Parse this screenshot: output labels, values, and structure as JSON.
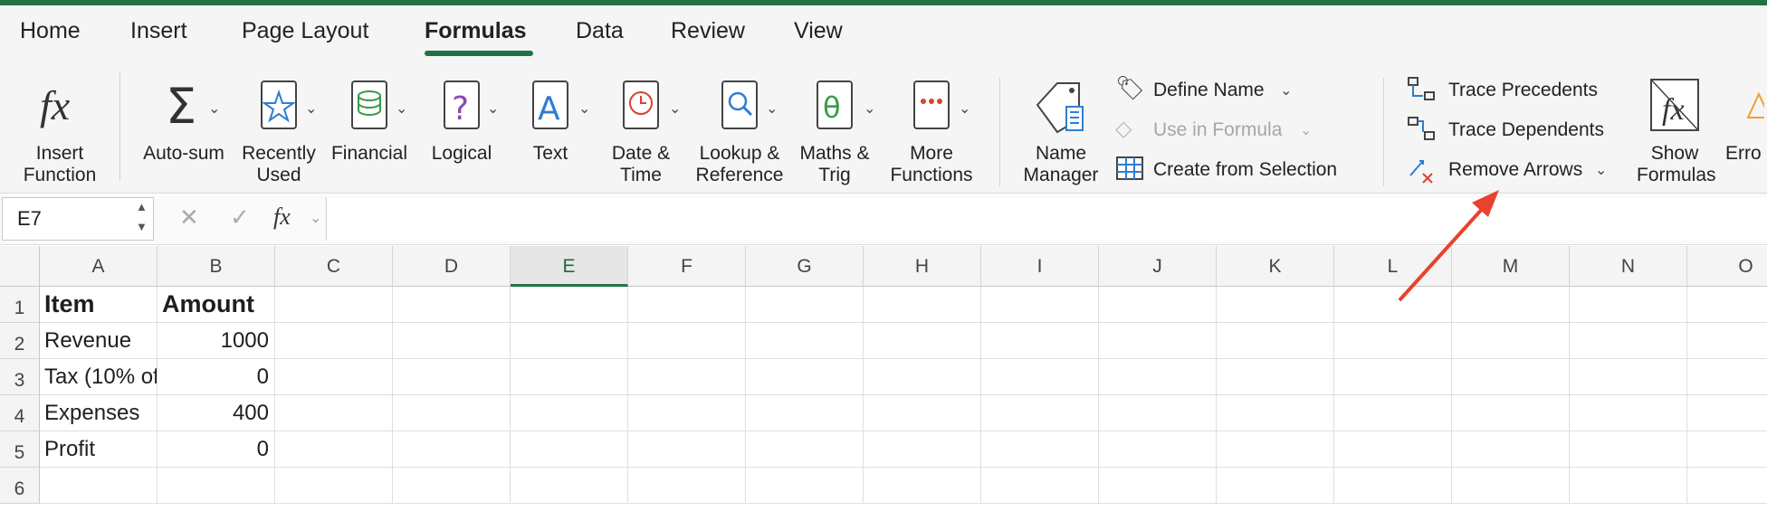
{
  "tabs": [
    {
      "label": "Home"
    },
    {
      "label": "Insert"
    },
    {
      "label": "Page Layout"
    },
    {
      "label": "Formulas"
    },
    {
      "label": "Data"
    },
    {
      "label": "Review"
    },
    {
      "label": "View"
    }
  ],
  "ribbon": {
    "insert_function": {
      "line1": "Insert",
      "line2": "Function",
      "icon": "fx-icon"
    },
    "autosum": {
      "line1": "Auto-sum",
      "icon": "sigma-icon"
    },
    "recently_used": {
      "line1": "Recently",
      "line2": "Used",
      "icon": "star-book-icon"
    },
    "financial": {
      "line1": "Financial",
      "icon": "coins-book-icon"
    },
    "logical": {
      "line1": "Logical",
      "icon": "question-book-icon"
    },
    "text": {
      "line1": "Text",
      "icon": "letter-book-icon"
    },
    "date_time": {
      "line1": "Date &",
      "line2": "Time",
      "icon": "clock-book-icon"
    },
    "lookup": {
      "line1": "Lookup &",
      "line2": "Reference",
      "icon": "magnifier-book-icon"
    },
    "maths": {
      "line1": "Maths &",
      "line2": "Trig",
      "icon": "theta-book-icon"
    },
    "more": {
      "line1": "More",
      "line2": "Functions",
      "icon": "dots-book-icon"
    },
    "name_manager": {
      "line1": "Name",
      "line2": "Manager",
      "icon": "tag-icon"
    },
    "define_name": "Define Name",
    "use_in_formula": "Use in Formula",
    "create_from_selection": "Create from Selection",
    "trace_precedents": "Trace Precedents",
    "trace_dependents": "Trace Dependents",
    "remove_arrows": "Remove Arrows",
    "show_formulas": {
      "line1": "Show",
      "line2": "Formulas"
    },
    "error_checking": {
      "line1": "Erro"
    }
  },
  "formula_bar": {
    "name_box": "E7",
    "cancel": "✕",
    "confirm": "✓",
    "fx": "fx",
    "formula": ""
  },
  "columns": [
    "A",
    "B",
    "C",
    "D",
    "E",
    "F",
    "G",
    "H",
    "I",
    "J",
    "K",
    "L",
    "M",
    "N",
    "O"
  ],
  "selected_column": "E",
  "rows": [
    "1",
    "2",
    "3",
    "4",
    "5",
    "6"
  ],
  "cells": {
    "A1": "Item",
    "B1": "Amount",
    "A2": "Revenue",
    "B2": "1000",
    "A3": "Tax (10% of",
    "B3": "0",
    "A4": "Expenses",
    "B4": "400",
    "A5": "Profit",
    "B5": "0"
  },
  "colors": {
    "accent": "#217346",
    "annotation_arrow": "#e8432d"
  }
}
